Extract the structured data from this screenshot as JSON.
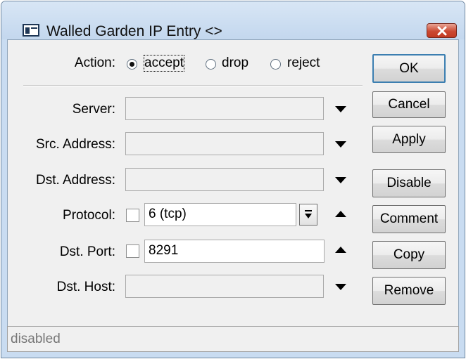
{
  "window": {
    "title": "Walled Garden IP Entry <>"
  },
  "action": {
    "label": "Action:",
    "options": [
      "accept",
      "drop",
      "reject"
    ],
    "selected": "accept"
  },
  "fields": {
    "server": {
      "label": "Server:",
      "value": ""
    },
    "src_address": {
      "label": "Src. Address:",
      "value": ""
    },
    "dst_address": {
      "label": "Dst. Address:",
      "value": ""
    },
    "protocol": {
      "label": "Protocol:",
      "value": "6 (tcp)",
      "negate": false
    },
    "dst_port": {
      "label": "Dst. Port:",
      "value": "8291",
      "negate": false
    },
    "dst_host": {
      "label": "Dst. Host:",
      "value": ""
    }
  },
  "buttons": {
    "ok": "OK",
    "cancel": "Cancel",
    "apply": "Apply",
    "disable": "Disable",
    "comment": "Comment",
    "copy": "Copy",
    "remove": "Remove"
  },
  "status": {
    "text": "disabled"
  },
  "icons": {
    "app": "window-icon",
    "close": "close-icon"
  },
  "colors": {
    "titlebar": "#c3d7ee",
    "close_button": "#c23a22",
    "client": "#f0f0f0"
  }
}
